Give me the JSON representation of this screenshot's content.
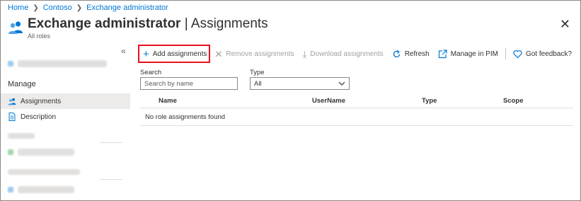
{
  "breadcrumb": {
    "items": [
      "Home",
      "Contoso",
      "Exchange administrator"
    ]
  },
  "header": {
    "title_bold": "Exchange administrator",
    "title_rest": " | Assignments",
    "subtitle": "All roles"
  },
  "sidebar": {
    "collapse_glyph": "«",
    "section_label": "Manage",
    "items": [
      {
        "label": "Assignments",
        "icon": "people-icon"
      },
      {
        "label": "Description",
        "icon": "document-icon"
      }
    ]
  },
  "toolbar": {
    "add_assignments": "Add assignments",
    "remove_assignments": "Remove assignments",
    "download_assignments": "Download assignments",
    "refresh": "Refresh",
    "manage_in_pim": "Manage in PIM",
    "got_feedback": "Got feedback?"
  },
  "filters": {
    "search_label": "Search",
    "search_placeholder": "Search by name",
    "type_label": "Type",
    "type_value": "All"
  },
  "grid": {
    "columns": [
      "Name",
      "UserName",
      "Type",
      "Scope"
    ],
    "empty_message": "No role assignments found"
  },
  "colors": {
    "accent": "#0078d4",
    "highlight_border": "#e81123",
    "active_nav": "#edebe9"
  }
}
